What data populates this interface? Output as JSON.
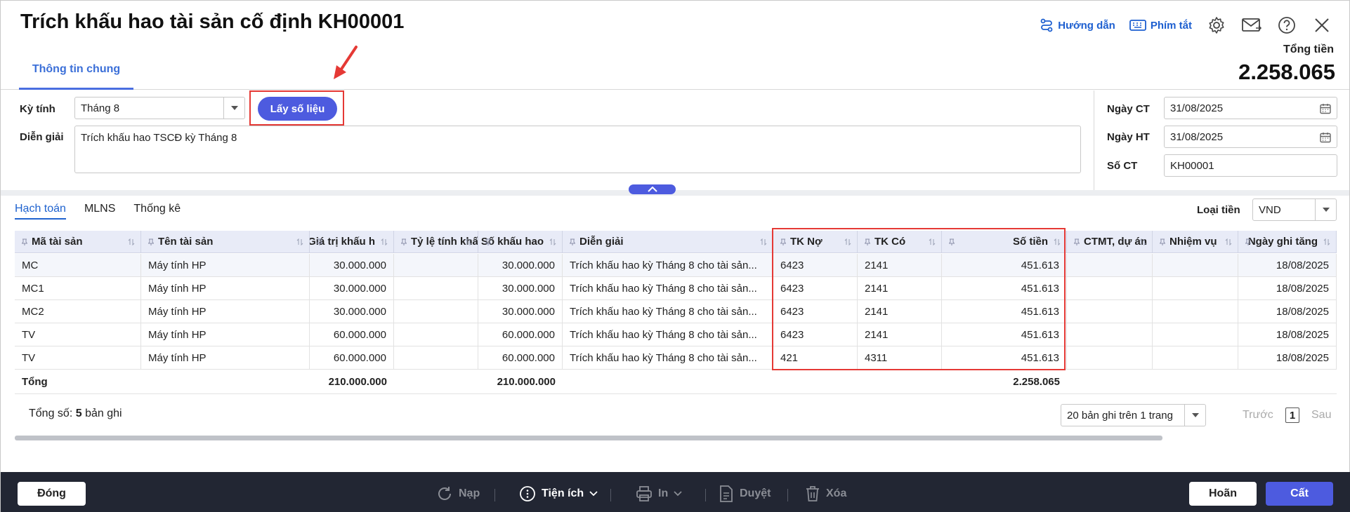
{
  "header": {
    "title": "Trích khấu hao tài sản cố định KH00001",
    "help_label": "Hướng dẫn",
    "shortcut_label": "Phím tắt",
    "total_label": "Tổng tiền",
    "total_value": "2.258.065"
  },
  "tabs": [
    {
      "label": "Thông tin chung"
    }
  ],
  "form": {
    "period_label": "Kỳ tính",
    "period_value": "Tháng 8",
    "fetch_button": "Lấy số liệu",
    "desc_label": "Diễn giải",
    "desc_value": "Trích khấu hao TSCĐ kỳ Tháng 8",
    "doc_date_label": "Ngày CT",
    "doc_date_value": "31/08/2025",
    "post_date_label": "Ngày HT",
    "post_date_value": "31/08/2025",
    "doc_no_label": "Số CT",
    "doc_no_value": "KH00001"
  },
  "subtabs": [
    "Hạch toán",
    "MLNS",
    "Thống kê"
  ],
  "currency": {
    "label": "Loại tiền",
    "value": "VND"
  },
  "table": {
    "columns": [
      "Mã tài sản",
      "Tên tài sản",
      "Giá trị khấu h",
      "Tỷ lệ tính khấ",
      "Số khấu hao",
      "Diễn giải",
      "TK Nợ",
      "TK Có",
      "Số tiền",
      "CTMT, dự án",
      "Nhiệm vụ",
      "Ngày ghi tăng"
    ],
    "rows": [
      [
        "MC",
        "Máy tính HP",
        "30.000.000",
        "",
        "30.000.000",
        "Trích khấu hao kỳ Tháng 8 cho tài sản...",
        "6423",
        "2141",
        "451.613",
        "",
        "",
        "18/08/2025"
      ],
      [
        "MC1",
        "Máy tính HP",
        "30.000.000",
        "",
        "30.000.000",
        "Trích khấu hao kỳ Tháng 8 cho tài sản...",
        "6423",
        "2141",
        "451.613",
        "",
        "",
        "18/08/2025"
      ],
      [
        "MC2",
        "Máy tính HP",
        "30.000.000",
        "",
        "30.000.000",
        "Trích khấu hao kỳ Tháng 8 cho tài sản...",
        "6423",
        "2141",
        "451.613",
        "",
        "",
        "18/08/2025"
      ],
      [
        "TV",
        "Máy tính HP",
        "60.000.000",
        "",
        "60.000.000",
        "Trích khấu hao kỳ Tháng 8 cho tài sản...",
        "6423",
        "2141",
        "451.613",
        "",
        "",
        "18/08/2025"
      ],
      [
        "TV",
        "Máy tính HP",
        "60.000.000",
        "",
        "60.000.000",
        "Trích khấu hao kỳ Tháng 8 cho tài sản...",
        "421",
        "4311",
        "451.613",
        "",
        "",
        "18/08/2025"
      ]
    ],
    "totals": {
      "label": "Tổng",
      "value_total": "210.000.000",
      "depr_total": "210.000.000",
      "amount_total": "2.258.065"
    }
  },
  "pager": {
    "count_prefix": "Tổng số:",
    "count": "5",
    "count_suffix": "bản ghi",
    "page_size": "20 bản ghi trên 1 trang",
    "prev": "Trước",
    "page": "1",
    "next": "Sau"
  },
  "footer": {
    "close": "Đóng",
    "reload": "Nạp",
    "utilities": "Tiện ích",
    "print": "In",
    "approve": "Duyệt",
    "delete": "Xóa",
    "cancel": "Hoãn",
    "save": "Cất"
  },
  "colors": {
    "accent": "#4d5bdf",
    "highlight": "#e53935",
    "footer": "#222633"
  }
}
